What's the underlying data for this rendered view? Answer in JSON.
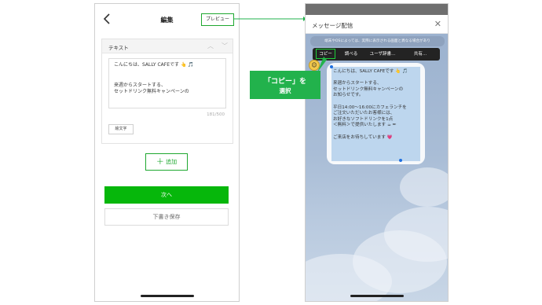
{
  "edit_screen": {
    "title": "編集",
    "preview_label": "プレビュー",
    "card_label": "テキスト",
    "message_lines": [
      "こんにちは、SALLY CAFEです",
      "",
      "",
      "来週からスタートする、",
      "セットドリンク無料キャンペーンの"
    ],
    "char_count": "181/500",
    "emoji_button": "絵文字",
    "add_button": "追加",
    "next_button": "次へ",
    "draft_button": "下書き保存"
  },
  "preview_screen": {
    "title": "メッセージ配信",
    "notice": "端末やOSによっては、実際に表示される画面と異なる場合があり",
    "menu_items": [
      "コピー",
      "調べる",
      "ユーザ辞書...",
      "共有..."
    ],
    "message_lines": [
      "こんにちは、SALLY CAFEです",
      "",
      "来週からスタートする、",
      "セットドリンク無料キャンペーンの",
      "お知らせです。",
      "",
      "平日14:00～16:00にカフェランチを",
      "ご注文いただいたお客様には、",
      "お好きなソフトドリンクを1点",
      "＜無料＞で提供いたします",
      "",
      "ご来店をお待ちしています"
    ]
  },
  "callout": {
    "line1": "「コピー」を",
    "line2": "選択"
  },
  "colors": {
    "accent_green": "#06b70b",
    "callout_green": "#22b24c",
    "selection_blue": "#bdd6ee"
  }
}
